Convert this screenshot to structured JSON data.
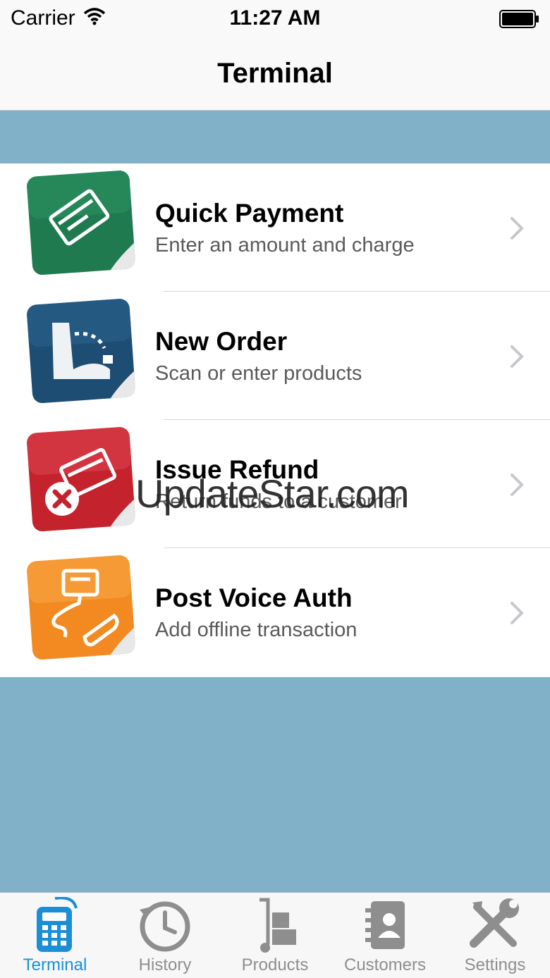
{
  "status": {
    "carrier": "Carrier",
    "time": "11:27 AM"
  },
  "nav": {
    "title": "Terminal"
  },
  "menu": [
    {
      "title": "Quick Payment",
      "subtitle": "Enter an amount and charge",
      "icon": "credit-card-icon",
      "color": "#1f7a4f"
    },
    {
      "title": "New Order",
      "subtitle": "Scan or enter products",
      "icon": "cash-register-icon",
      "color": "#1d4d72"
    },
    {
      "title": "Issue Refund",
      "subtitle": "Return funds to a customer",
      "icon": "refund-card-icon",
      "color": "#c4222c"
    },
    {
      "title": "Post Voice Auth",
      "subtitle": "Add offline transaction",
      "icon": "phone-terminal-icon",
      "color": "#f28a21"
    }
  ],
  "watermark": "UpdateStar.com",
  "tabs": [
    {
      "label": "Terminal",
      "icon": "terminal-icon",
      "active": true
    },
    {
      "label": "History",
      "icon": "clock-icon",
      "active": false
    },
    {
      "label": "Products",
      "icon": "hand-truck-icon",
      "active": false
    },
    {
      "label": "Customers",
      "icon": "address-book-icon",
      "active": false
    },
    {
      "label": "Settings",
      "icon": "wrench-icon",
      "active": false
    }
  ],
  "colors": {
    "accent": "#1a8fd8",
    "background": "#80b1c9",
    "inactive": "#8e8e8e"
  }
}
